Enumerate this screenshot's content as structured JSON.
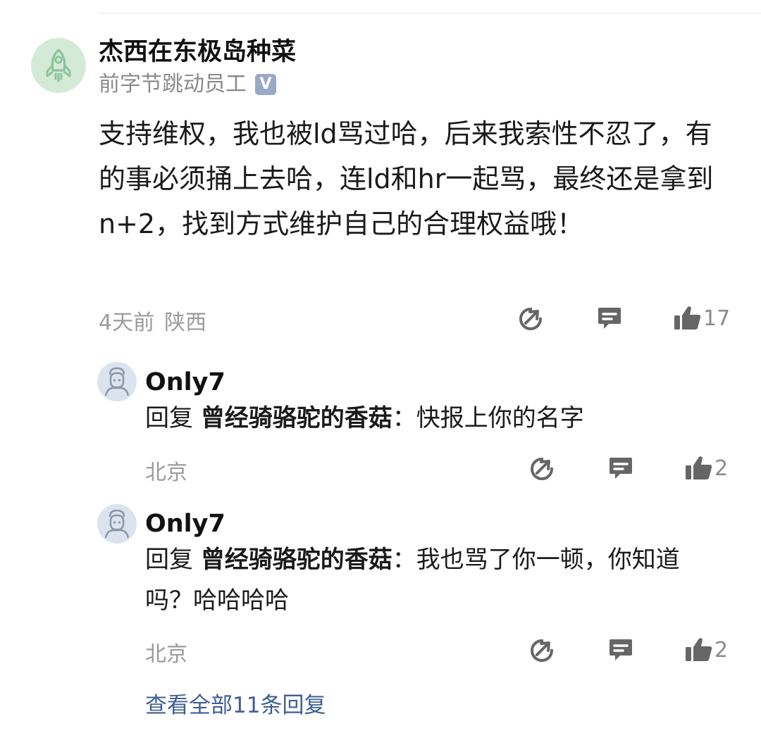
{
  "comment": {
    "username": "杰西在东极岛种菜",
    "subtitle": "前字节跳动员工",
    "verified_badge": "V",
    "body": "支持维权，我也被ld骂过哈，后来我索性不忍了，有的事必须捅上去哈，连ld和hr一起骂，最终还是拿到n+2，找到方式维护自己的合理权益哦！",
    "time": "4天前",
    "location": "陕西",
    "like_count": "17",
    "icons": {
      "avatar": "rocket-icon",
      "share": "share-icon",
      "reply": "comment-icon",
      "like": "thumbs-up-icon"
    }
  },
  "replies": [
    {
      "username": "Only7",
      "reply_prefix": "回复",
      "reply_target": "曾经骑骆驼的香菇",
      "text": "：快报上你的名字",
      "location": "北京",
      "like_count": "2"
    },
    {
      "username": "Only7",
      "reply_prefix": "回复",
      "reply_target": "曾经骑骆驼的香菇",
      "text": "：我也骂了你一顿，你知道吗？哈哈哈哈",
      "location": "北京",
      "like_count": "2"
    }
  ],
  "view_all_replies": "查看全部11条回复",
  "colors": {
    "link": "#3d5f93",
    "meta_text": "#9b9b9b",
    "icon": "#666666",
    "main_avatar_bg": "#d3ebd6",
    "reply_avatar_bg": "#dbe3ef"
  }
}
